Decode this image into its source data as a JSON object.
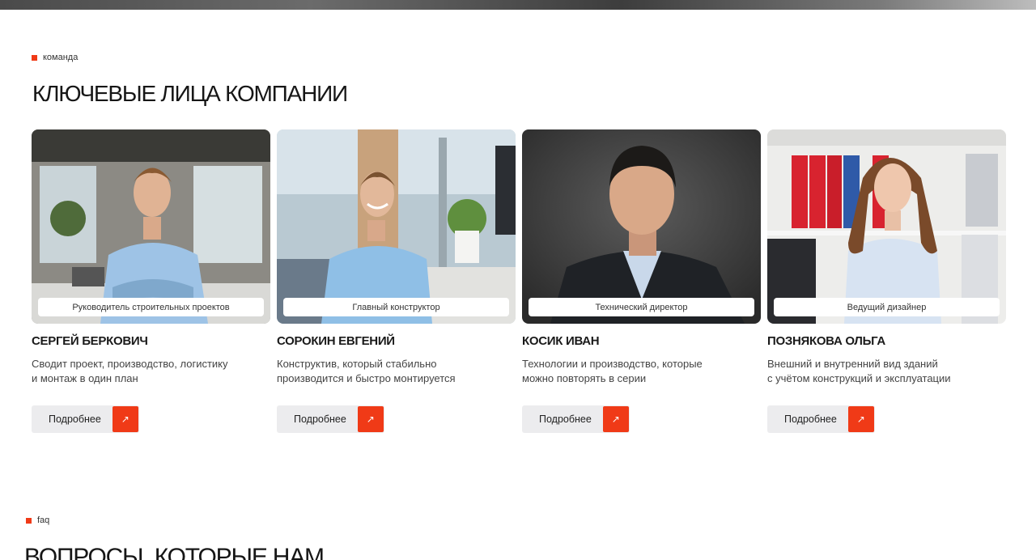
{
  "team": {
    "tag": "команда",
    "title": "КЛЮЧЕВЫЕ ЛИЦА КОМПАНИИ",
    "more_label": "Подробнее",
    "members": [
      {
        "role": "Руководитель строительных проектов",
        "name": "СЕРГЕЙ БЕРКОВИЧ",
        "desc1": "Сводит проект, производство, логистику",
        "desc2": "и монтаж в один план"
      },
      {
        "role": "Главный конструктор",
        "name": "СОРОКИН ЕВГЕНИЙ",
        "desc1": "Конструктив, который стабильно",
        "desc2": "производится и быстро монтируется"
      },
      {
        "role": "Технический директор",
        "name": "КОСИК ИВАН",
        "desc1": "Технологии и производство, которые",
        "desc2": "можно повторять в серии"
      },
      {
        "role": "Ведущий дизайнер",
        "name": "ПОЗНЯКОВА ОЛЬГА",
        "desc1": "Внешний и внутренний вид зданий",
        "desc2": "с учётом конструкций и эксплуатации"
      }
    ]
  },
  "faq": {
    "tag": "faq",
    "title": "ВОПРОСЫ, КОТОРЫЕ НАМ"
  },
  "colors": {
    "accent": "#f03a17",
    "button_bg": "#ececee"
  },
  "icons": {
    "more_arrow": "arrow-up-right-icon"
  }
}
